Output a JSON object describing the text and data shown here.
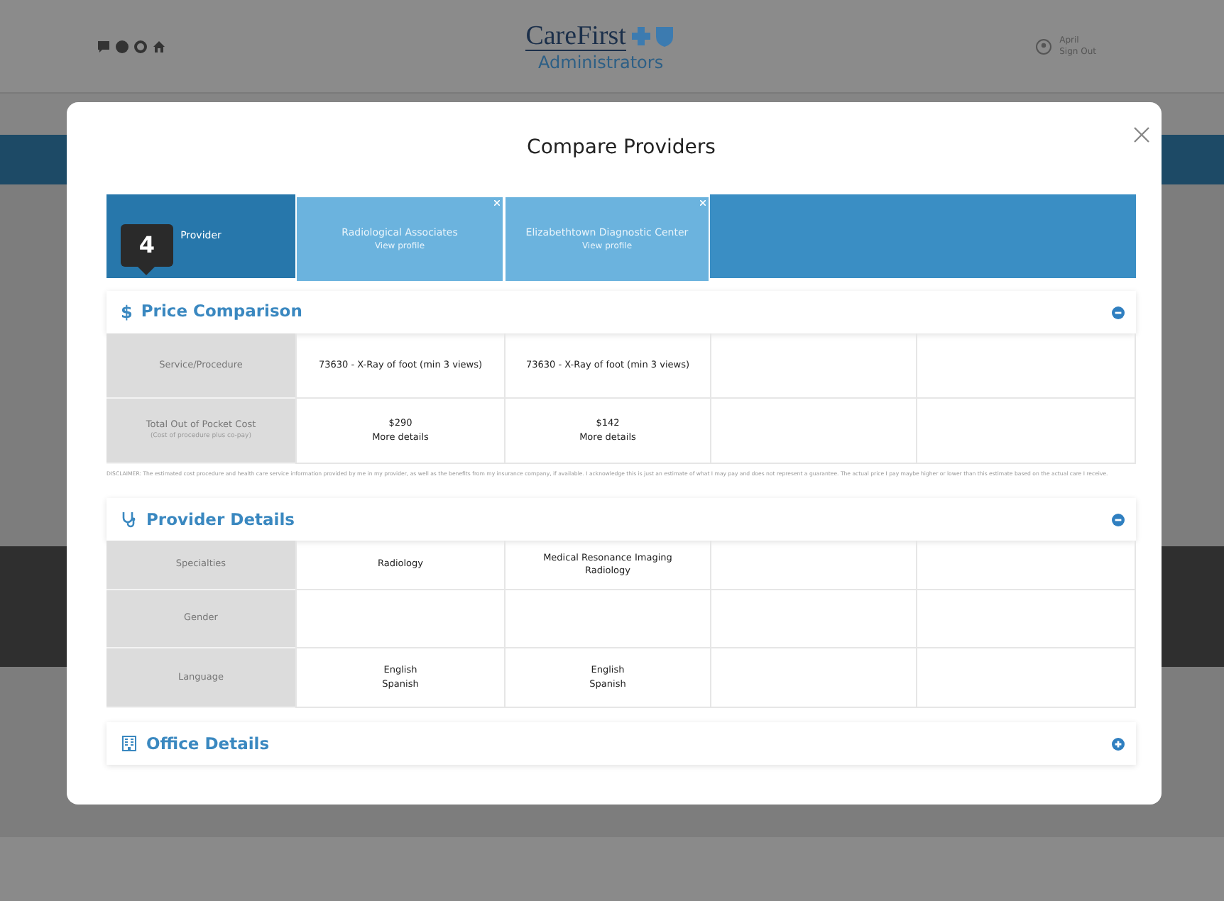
{
  "top_bar": {
    "logo": "CareFirst",
    "logo_subtitle": "Administrators",
    "user_name": "April",
    "sign_out": "Sign Out"
  },
  "modal": {
    "title": "Compare Providers",
    "compare_header": {
      "label": "Provider",
      "providers": [
        {
          "name": "Radiological Associates",
          "link": "View profile"
        },
        {
          "name": "Elizabethtown Diagnostic Center",
          "link": "View profile"
        }
      ]
    },
    "callout": {
      "label": "4"
    },
    "sections": [
      {
        "kind": "price",
        "icon_text": "$",
        "title": "Price Comparison",
        "expanded": true,
        "rows": [
          {
            "kind": "text",
            "label": "Service/Procedure",
            "cells": [
              [
                "73630 -  X-Ray of foot (min 3 views)"
              ],
              [
                "73630 -  X-Ray of foot (min 3 views)"
              ]
            ]
          },
          {
            "kind": "price",
            "label": "Total Out of Pocket Cost",
            "note": "(Cost of procedure plus co-pay)",
            "cells": [
              {
                "price": "$290",
                "link": "More details"
              },
              {
                "price": "$142",
                "link": "More details"
              }
            ]
          }
        ],
        "disclaimer": "DISCLAIMER: The estimated cost procedure and health care service information provided by me in my provider, as well as the benefits from my insurance company, if available. I acknowledge this is just an estimate of what I may pay and does not represent a guarantee. The actual price I pay maybe higher or lower than this estimate based on the actual care I receive."
      },
      {
        "kind": "provider",
        "title": "Provider Details",
        "expanded": true,
        "rows": [
          {
            "kind": "text",
            "label": "Specialties",
            "cells": [
              [
                "Radiology"
              ],
              [
                "Medical Resonance Imaging",
                "Radiology"
              ]
            ]
          },
          {
            "kind": "text",
            "label": "Gender",
            "cells": []
          },
          {
            "kind": "text",
            "label": "Language",
            "cells": [
              [
                "English",
                "Spanish"
              ],
              [
                "English",
                "Spanish"
              ]
            ]
          }
        ]
      },
      {
        "kind": "office",
        "title": "Office Details",
        "expanded": false
      }
    ]
  }
}
